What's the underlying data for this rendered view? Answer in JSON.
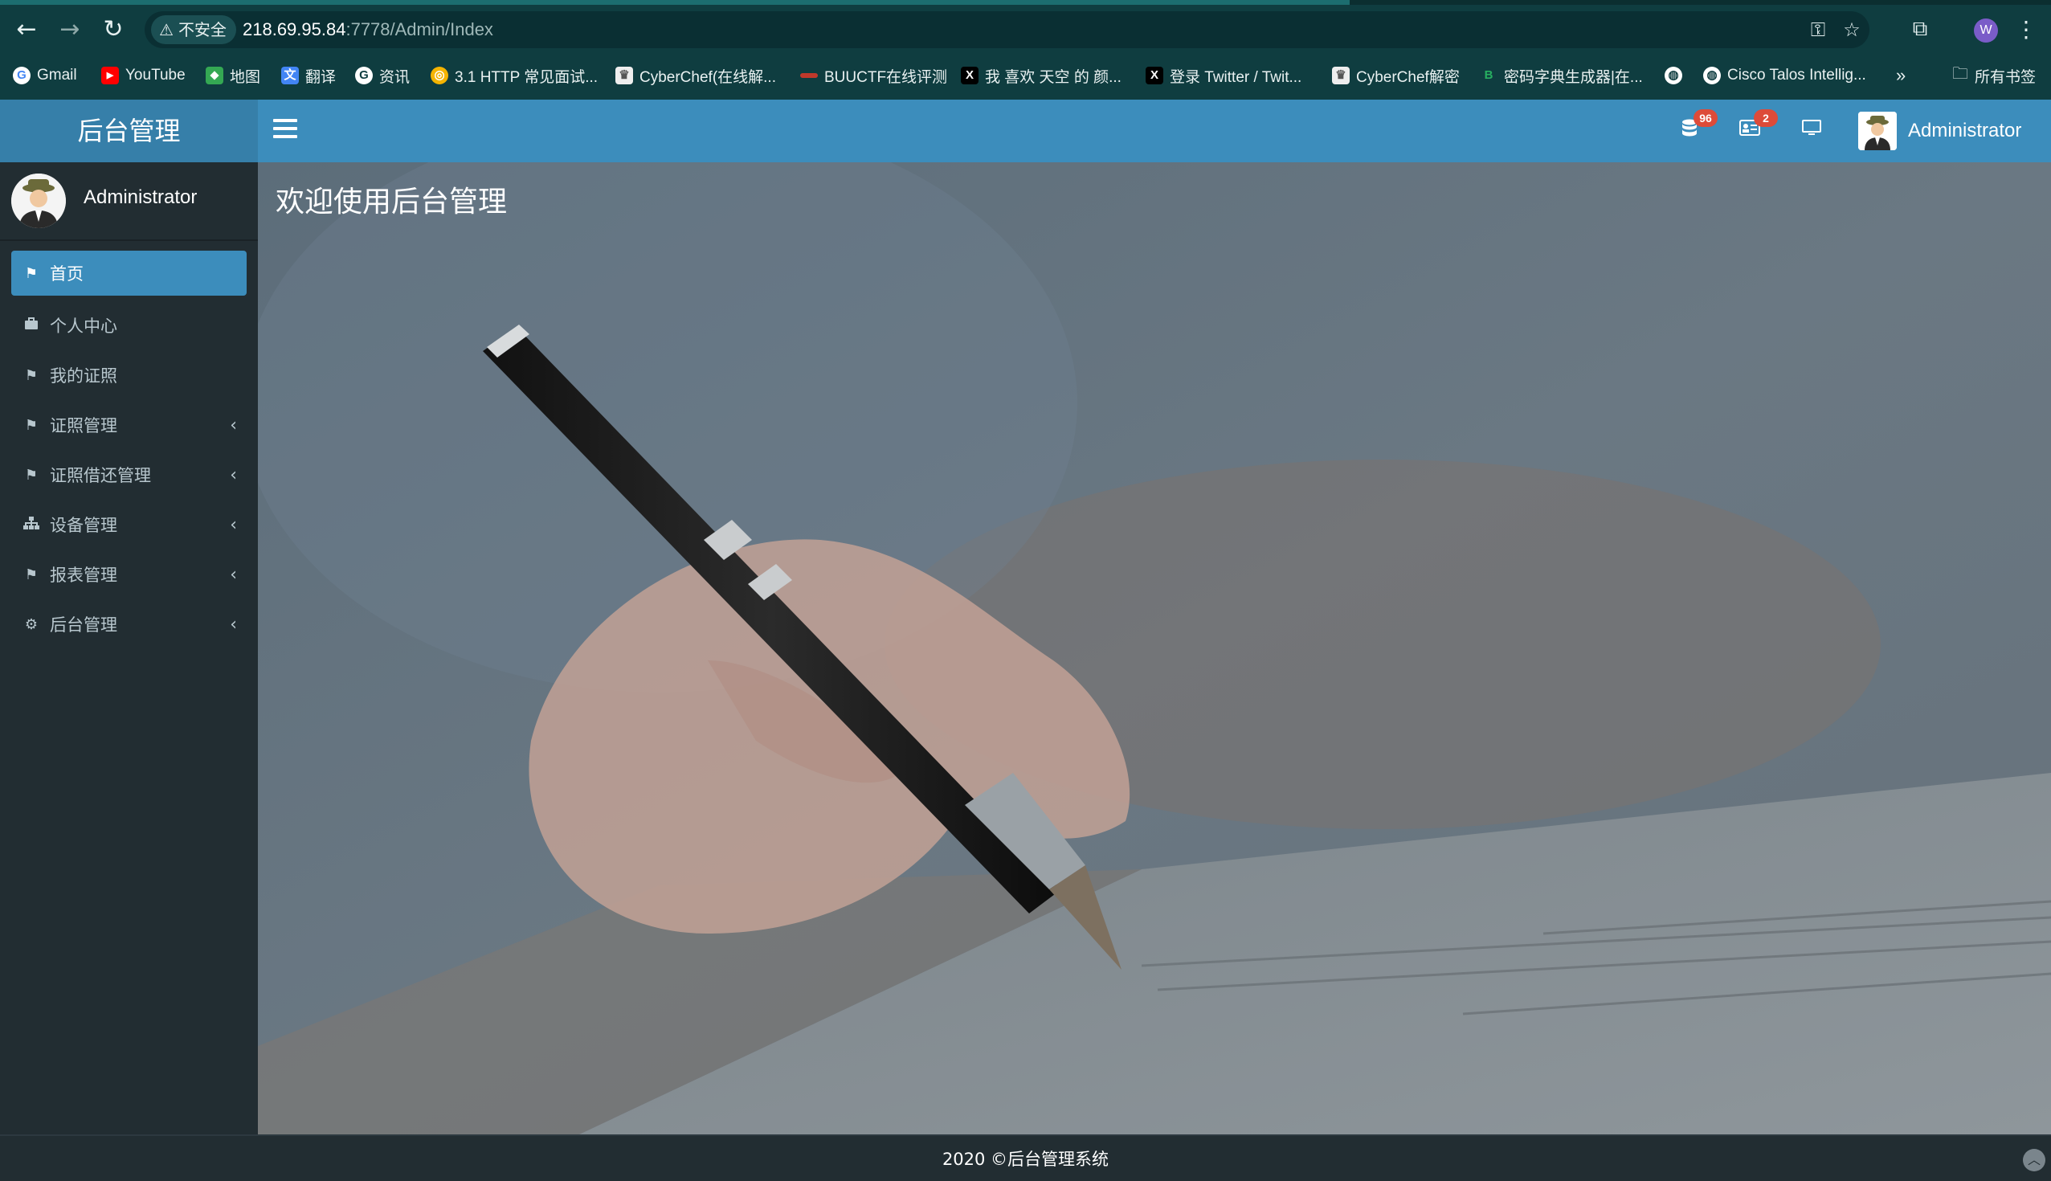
{
  "browser": {
    "security_label": "不安全",
    "url_host": "218.69.95.84",
    "url_path": ":7778/Admin/Index",
    "profile_initial": "W",
    "bookmarks": [
      {
        "label": "Gmail",
        "icon": "google-icon",
        "color": "#ffffff"
      },
      {
        "label": "YouTube",
        "icon": "youtube-icon",
        "color": "#ff0000"
      },
      {
        "label": "地图",
        "icon": "maps-icon",
        "color": "#34a853"
      },
      {
        "label": "翻译",
        "icon": "translate-icon",
        "color": "#4285f4"
      },
      {
        "label": "资讯",
        "icon": "news-icon",
        "color": "#ffffff"
      },
      {
        "label": "3.1 HTTP 常见面试...",
        "icon": "site-icon",
        "color": "#f4b400"
      },
      {
        "label": "CyberChef(在线解...",
        "icon": "chef-icon",
        "color": "#eeeeee"
      },
      {
        "label": "BUUCTF在线评测",
        "icon": "buuctf-icon",
        "color": "#c0392b"
      },
      {
        "label": "我 喜欢 天空 的 颜...",
        "icon": "x-icon",
        "color": "#000000"
      },
      {
        "label": "登录 Twitter / Twit...",
        "icon": "x-icon",
        "color": "#000000"
      },
      {
        "label": "CyberChef解密",
        "icon": "chef-icon",
        "color": "#eeeeee"
      },
      {
        "label": "密码字典生成器|在...",
        "icon": "b-icon",
        "color": "#27ae60"
      },
      {
        "label": "",
        "icon": "globe-icon",
        "color": "#ffffff"
      },
      {
        "label": "Cisco Talos Intellig...",
        "icon": "globe-icon",
        "color": "#ffffff"
      }
    ],
    "more_label": "»",
    "all_bookmarks_label": "所有书签"
  },
  "header": {
    "brand": "后台管理",
    "badge_db": "96",
    "badge_card": "2",
    "user_name": "Administrator"
  },
  "sidebar": {
    "user_name": "Administrator",
    "items": [
      {
        "label": "首页",
        "icon": "flag-icon",
        "active": true,
        "has_children": false
      },
      {
        "label": "个人中心",
        "icon": "briefcase-icon",
        "active": false,
        "has_children": false
      },
      {
        "label": "我的证照",
        "icon": "flag-icon",
        "active": false,
        "has_children": false
      },
      {
        "label": "证照管理",
        "icon": "flag-icon",
        "active": false,
        "has_children": true
      },
      {
        "label": "证照借还管理",
        "icon": "flag-icon",
        "active": false,
        "has_children": true
      },
      {
        "label": "设备管理",
        "icon": "sitemap-icon",
        "active": false,
        "has_children": true
      },
      {
        "label": "报表管理",
        "icon": "flag-icon",
        "active": false,
        "has_children": true
      },
      {
        "label": "后台管理",
        "icon": "gear-icon",
        "active": false,
        "has_children": true
      }
    ]
  },
  "content": {
    "title": "欢迎使用后台管理"
  },
  "footer": {
    "text": "2020 ©后台管理系统"
  },
  "colors": {
    "primary": "#3c8dbc",
    "sidebar": "#222d32",
    "badge": "#dd4b39"
  }
}
